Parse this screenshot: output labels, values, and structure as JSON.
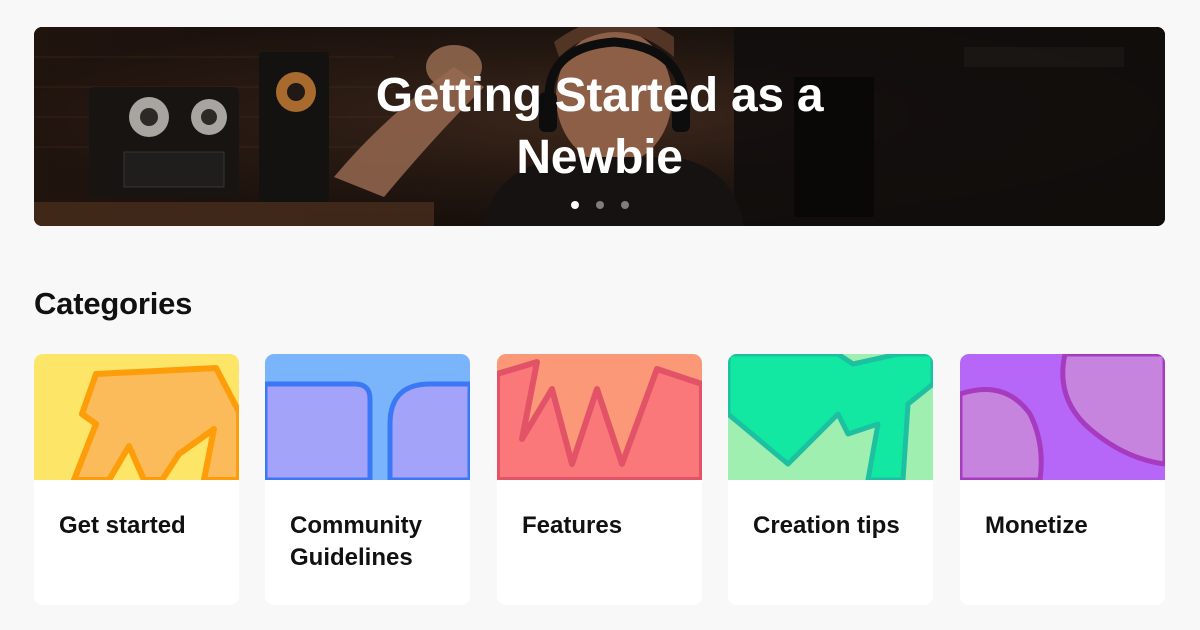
{
  "hero": {
    "title_line1": "Getting Started as a",
    "title_line2": "Newbie",
    "slides": [
      {
        "active": true
      },
      {
        "active": false
      },
      {
        "active": false
      }
    ]
  },
  "categories": {
    "heading": "Categories",
    "items": [
      {
        "label": "Get started",
        "art": "arrow-shape",
        "colors": {
          "bg": "#fde568",
          "shape": "#fbbb5a",
          "stroke": "#fd9d0a"
        }
      },
      {
        "label": "Community Guidelines",
        "art": "arch-shape",
        "colors": {
          "bg": "#7ab5fc",
          "shape": "#a3a3fa",
          "stroke": "#3b78f5"
        }
      },
      {
        "label": "Features",
        "art": "zigzag-shape",
        "colors": {
          "bg": "#fb9877",
          "shape": "#fb787a",
          "stroke": "#e35368"
        }
      },
      {
        "label": "Creation tips",
        "art": "bolt-shape",
        "colors": {
          "bg": "#9eefb0",
          "shape": "#13e8a2",
          "stroke": "#1ec0a2"
        }
      },
      {
        "label": "Monetize",
        "art": "blob-shape",
        "colors": {
          "bg": "#b667f7",
          "shape": "#c784df",
          "stroke": "#a73bbf"
        }
      }
    ]
  }
}
